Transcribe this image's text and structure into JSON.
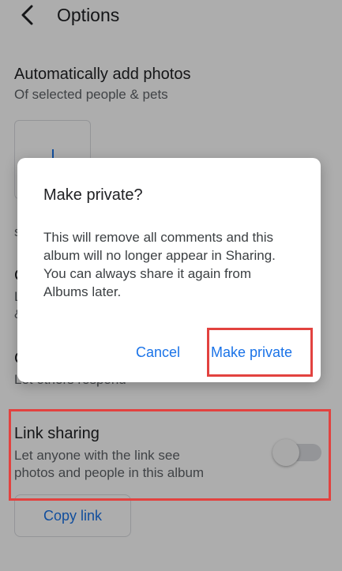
{
  "header": {
    "title": "Options"
  },
  "auto_add": {
    "title": "Automatically add photos",
    "subtitle": "Of selected people & pets"
  },
  "partial_text": {
    "s": "s",
    "c1": "C",
    "l": "L",
    "amp": "&",
    "c2": "C",
    "let_others": "Let others respond"
  },
  "link_sharing": {
    "title": "Link sharing",
    "description_line1": "Let anyone with the link see",
    "description_line2": "photos and people in this album",
    "enabled": false
  },
  "copy_link": {
    "label": "Copy link"
  },
  "dialog": {
    "title": "Make private?",
    "body": "This will remove all comments and this album will no longer appear in Sharing. You can always share it again from Albums later.",
    "cancel_label": "Cancel",
    "confirm_label": "Make private"
  },
  "colors": {
    "accent": "#1a73e8",
    "highlight": "#e2423f"
  }
}
